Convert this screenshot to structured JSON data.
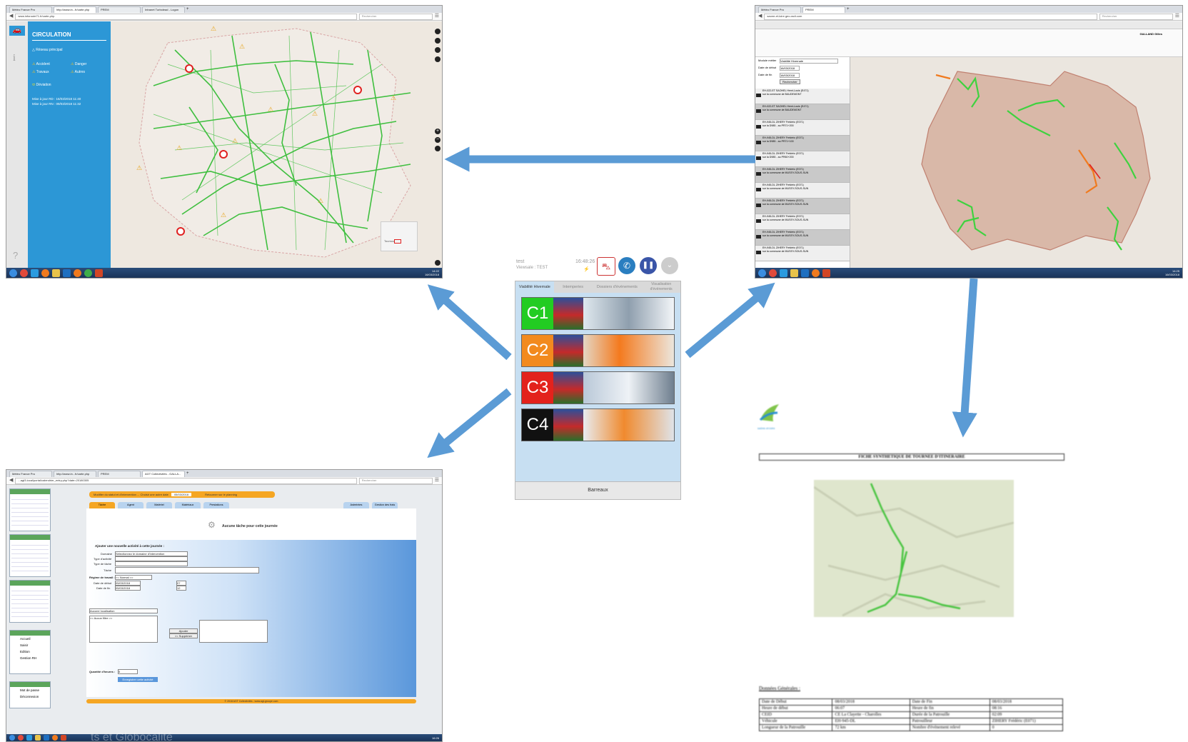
{
  "arrow_color": "#5b9bd5",
  "top_left": {
    "tabs": [
      "Météo France Pro",
      "http://www.in...fr/carte.php",
      "PREM",
      "Intranet Turbolead - Logon"
    ],
    "url": "www.inforoute71.fr/carte.php",
    "search_placeholder": "Rechercher",
    "panel": {
      "title": "CIRCULATION",
      "reseau": "Réseau principal",
      "accident": "Accident",
      "danger": "Danger",
      "travaux": "Travaux",
      "autres": "Autres",
      "deviation": "Déviation",
      "maj_rd": "Mise à jour RD",
      "maj_rd_date": "16/03/2018 11:40",
      "maj_rn": "Mise à jour RN",
      "maj_rn_date": "09/03/2018 11:32"
    },
    "clock_time": "14:22",
    "clock_date": "16/03/2018",
    "map_label": "Tournus"
  },
  "top_right": {
    "tabs": [
      "Météo France Pro",
      "PREM"
    ],
    "url": "saone-et-loire.geo-radi.com",
    "search_placeholder": "Rechercher",
    "user": "GALLAND Gilles",
    "form": {
      "module_label": "Module métier",
      "module_value": "Viabilité Hivernale",
      "date_debut_label": "Date de début",
      "date_debut": "16/03/2018",
      "date_fin_label": "Date de fin",
      "date_fin": "16/03/2018",
      "search_button": "Rechercher"
    },
    "list_items": [
      {
        "name": "EH-022-ET SAOHEL Henri-Louis (E471)",
        "line": "sur la commune de BAUDEMONT"
      },
      {
        "name": "EH-022-ET SAOHEL Henri-Louis (E471)",
        "line": "sur la commune de BAUDEMONT"
      },
      {
        "name": "EH-945-DL ZIHERY Frédéric (E071)",
        "line": "sur la D985 - au PR71+200"
      },
      {
        "name": "EH-945-DL ZIHERY Frédéric (E071)",
        "line": "sur la D985 - au PR71+100"
      },
      {
        "name": "EH-945-DL ZIHERY Frédéric (E071)",
        "line": "sur la D985 - au PR60+200"
      },
      {
        "name": "EH-945-DL ZIHERY Frédéric (E071)",
        "line": "sur la commune de MUSSY-SOUS-SUN"
      },
      {
        "name": "EH-945-DL ZIHERY Frédéric (E071)",
        "line": "sur la commune de MUSSY-SOUS-SUN"
      },
      {
        "name": "EH-945-DL ZIHERY Frédéric (E071)",
        "line": "sur la commune de MUSSY-SOUS-SUN"
      },
      {
        "name": "EH-945-DL ZIHERY Frédéric (E071)",
        "line": "sur la commune de MUSSY-SOUS-SUN"
      },
      {
        "name": "EH-945-DL ZIHERY Frédéric (E071)",
        "line": "sur la commune de MUSSY-SOUS-SUN"
      },
      {
        "name": "EH-945-DL ZIHERY Frédéric (E071)",
        "line": "sur la commune de MUSSY-SOUS-SUN"
      }
    ],
    "clock_time": "14:25",
    "clock_date": "16/03/2018"
  },
  "center": {
    "user_line1": "test",
    "user_line2": "Viewsale : TEST",
    "time": "16:48:26",
    "tabs": [
      "Viabilité Hivernale",
      "Intemperies",
      "Dossiers d'événements",
      "Visualisation d'événements"
    ],
    "circuits": [
      {
        "label": "C1",
        "color": "#22cc22"
      },
      {
        "label": "C2",
        "color": "#f28a1e"
      },
      {
        "label": "C3",
        "color": "#e3221c"
      },
      {
        "label": "C4",
        "color": "#111111"
      }
    ],
    "footer_button": "Barreaux"
  },
  "bottom_left": {
    "tabs": [
      "Météo France Pro",
      "http://www.in...fr/carte.php",
      "PREM",
      "AGT Collectivités - GALLA..."
    ],
    "url": "...agt3.local/portal/calendrier_entry.php?date=20180305",
    "search_placeholder": "Rechercher",
    "banner": "Modifier du statut et d'intervention ... Choisir une autre date",
    "banner_date": "05/03/2018",
    "banner_right": "Retourner sur le planning",
    "content_tabs": [
      "Tâche",
      "Agent",
      "Matériel",
      "Matériaux",
      "Prestations",
      "Astreintes",
      "Gestion des frais"
    ],
    "no_task": "Aucune tâche pour cette journée",
    "add_title": "Ajouter une nouvelle activité à cette journée :",
    "fields": {
      "domaine_label": "Domaine",
      "domaine_value": "Sélectionnez le domaine d'intervention",
      "type_activite_label": "Type d'activité",
      "type_tache_label": "Type de tâche",
      "tache_label": "Tâche",
      "regime_label": "Régime de travail :",
      "regime_value": "<< Normal >>",
      "date_debut_label": "Date de début",
      "date_debut": "05/03/2018",
      "date_fin_label": "Date de fin",
      "date_fin": "05/03/2018",
      "heure_debut": "07",
      "heure_fin": "12",
      "localisation": "Aucune localisation",
      "categorie": "<< Aucun filtre >>",
      "ajouter": "Ajouter",
      "supprimer": "<< Supprimer",
      "quantite_label": "Quantité d'heures :",
      "quantite": "5",
      "enregistrer": "Enregistrer cette activité"
    },
    "side_menu": [
      "Accueil",
      "Saisir",
      "Edition",
      "Gestion RH"
    ],
    "side_menu2": [
      "Mot de passe",
      "Déconnexion"
    ],
    "footer": "© 2018 AGT Collectivités - www.agt-groupe.com",
    "clock_time": "16:26",
    "watermark": "ts et Globocalité"
  },
  "bottom_right": {
    "logo_caption": "saône-et-loire",
    "title": "FICHE SYNTHETIQUE DE TOURNEE D'ITINERAIRE",
    "section": "Données Générales :",
    "rows": [
      [
        "Date de Début",
        "08/03/2018",
        "Date de Fin",
        "08/03/2018"
      ],
      [
        "Heure de début",
        "06:07",
        "Heure de fin",
        "08:16"
      ],
      [
        "CEID",
        "CE La Clayette - Charolles",
        "Durée de la Patrouille",
        "02:09"
      ],
      [
        "Véhicule",
        "EH-945-DL",
        "Patrouilleur",
        "ZIHERY Frédéric (E071)"
      ],
      [
        "Longueur de la Patrouille",
        "72 km",
        "Nombre d'événement relevé",
        "0"
      ]
    ]
  }
}
